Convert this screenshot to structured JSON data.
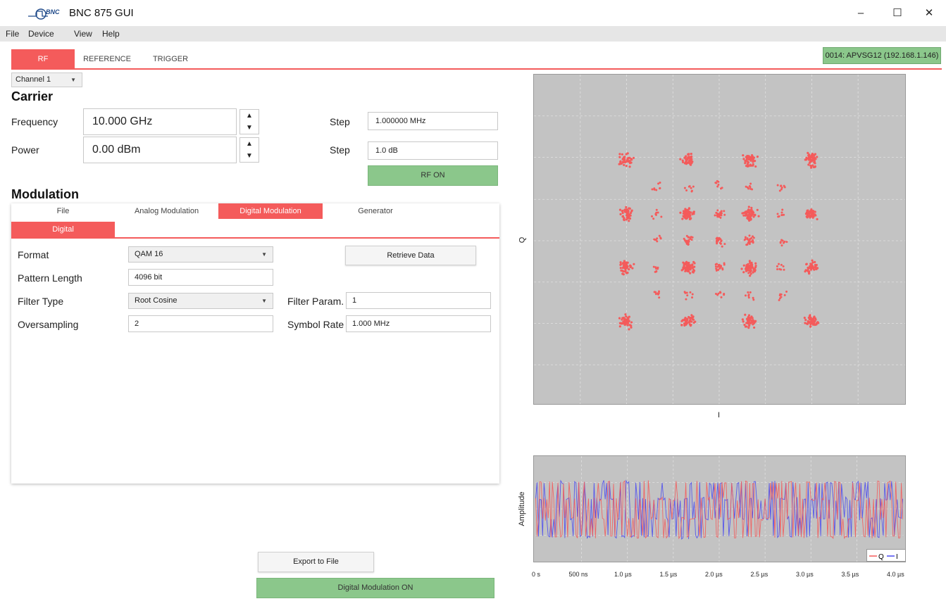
{
  "window": {
    "title": "BNC 875 GUI",
    "logo_text": "BNC",
    "minimize": "–",
    "maximize": "☐",
    "close": "✕"
  },
  "menu": [
    "File",
    "Device",
    "View",
    "Help"
  ],
  "tabs": [
    "RF",
    "REFERENCE",
    "TRIGGER"
  ],
  "device_badge": "0014: APVSG12 (192.168.1.146)",
  "channel": "Channel 1",
  "carrier": {
    "title": "Carrier",
    "frequency_label": "Frequency",
    "frequency_value": "10.000 GHz",
    "frequency_step_label": "Step",
    "frequency_step_value": "1.000000 MHz",
    "power_label": "Power",
    "power_value": "0.00 dBm",
    "power_step_label": "Step",
    "power_step_value": "1.0 dB",
    "rf_button": "RF ON"
  },
  "modulation": {
    "title": "Modulation",
    "tabs": [
      "File",
      "Analog Modulation",
      "Digital Modulation",
      "Generator"
    ],
    "subtab": "Digital",
    "format_label": "Format",
    "format_value": "QAM 16",
    "pattern_label": "Pattern Length",
    "pattern_value": "4096 bit",
    "filter_type_label": "Filter Type",
    "filter_type_value": "Root Cosine",
    "filter_param_label": "Filter Param.",
    "filter_param_value": "1",
    "oversampling_label": "Oversampling",
    "oversampling_value": "2",
    "symbol_rate_label": "Symbol Rate",
    "symbol_rate_value": "1.000 MHz",
    "retrieve_button": "Retrieve Data"
  },
  "export_button": "Export to File",
  "digital_on_button": "Digital Modulation ON",
  "colors": {
    "accent": "#f45b5b",
    "green": "#8bc78b",
    "plot_bg": "#c3c3c3",
    "q_trace": "#f45b5b",
    "i_trace": "#4b4bf0"
  },
  "chart_data": [
    {
      "type": "scatter",
      "title": "",
      "xlabel": "I",
      "ylabel": "Q",
      "grid": true,
      "description_points": "16-QAM constellation with inter-symbol points",
      "clusters_i": [
        -3,
        -1,
        1,
        3
      ],
      "clusters_q": [
        -3,
        -1,
        1,
        3
      ]
    },
    {
      "type": "line",
      "title": "",
      "xlabel": "",
      "ylabel": "Amplitude",
      "x_ticks": [
        "0 s",
        "500 ns",
        "1.0 µs",
        "1.5 µs",
        "2.0 µs",
        "2.5 µs",
        "3.0 µs",
        "3.5 µs",
        "4.0 µs"
      ],
      "series": [
        {
          "name": "Q"
        },
        {
          "name": "I"
        }
      ],
      "legend": "bottom-right",
      "grid": true
    }
  ]
}
